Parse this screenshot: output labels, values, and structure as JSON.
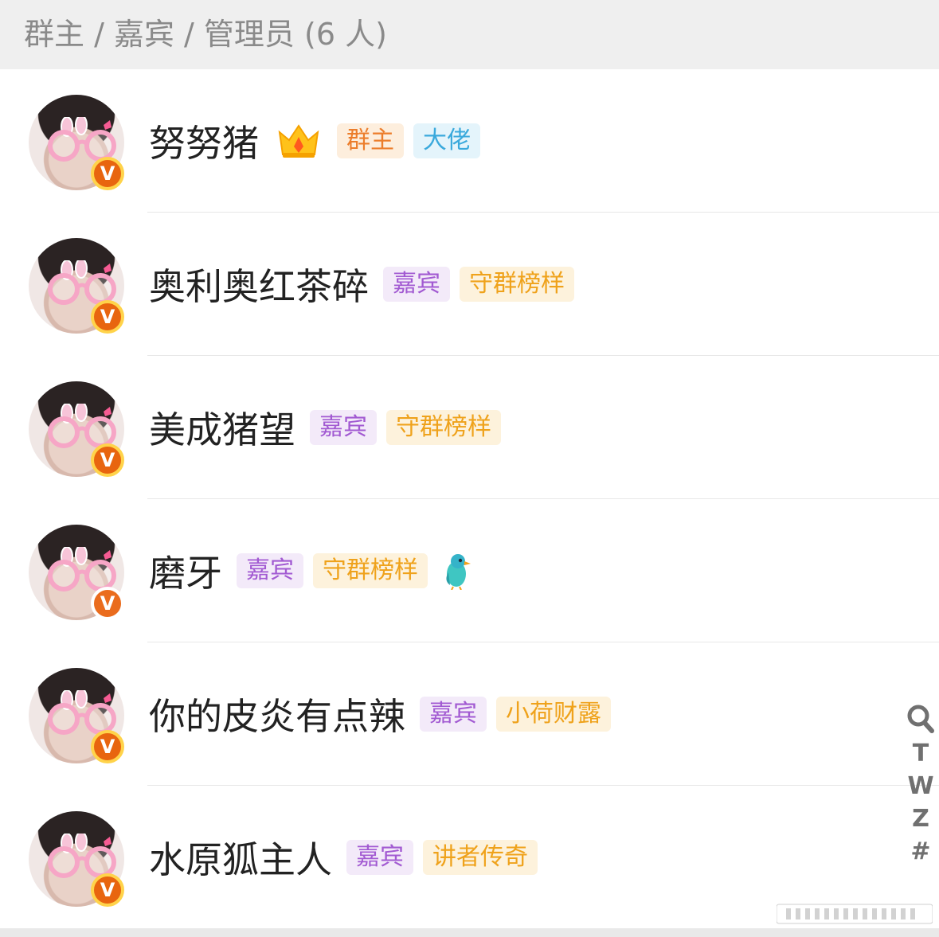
{
  "section": {
    "title": "群主 / 嘉宾 / 管理员 (6 人)"
  },
  "members": [
    {
      "name": "努努猪",
      "crown": true,
      "bird": false,
      "tags": [
        {
          "text": "群主",
          "kind": "owner"
        },
        {
          "text": "大佬",
          "kind": "boss"
        }
      ]
    },
    {
      "name": "奥利奥红茶碎",
      "crown": false,
      "bird": false,
      "tags": [
        {
          "text": "嘉宾",
          "kind": "guest"
        },
        {
          "text": "守群榜样",
          "kind": "gold"
        }
      ]
    },
    {
      "name": "美成猪望",
      "crown": false,
      "bird": false,
      "tags": [
        {
          "text": "嘉宾",
          "kind": "guest"
        },
        {
          "text": "守群榜样",
          "kind": "gold"
        }
      ]
    },
    {
      "name": "磨牙",
      "crown": false,
      "bird": true,
      "tags": [
        {
          "text": "嘉宾",
          "kind": "guest"
        },
        {
          "text": "守群榜样",
          "kind": "gold"
        }
      ]
    },
    {
      "name": "你的皮炎有点辣",
      "crown": false,
      "bird": false,
      "tags": [
        {
          "text": "嘉宾",
          "kind": "guest"
        },
        {
          "text": "小荷财露",
          "kind": "gold"
        }
      ]
    },
    {
      "name": "水原狐主人",
      "crown": false,
      "bird": false,
      "tags": [
        {
          "text": "嘉宾",
          "kind": "guest"
        },
        {
          "text": "讲者传奇",
          "kind": "gold"
        }
      ]
    }
  ],
  "verify_badge": "V",
  "index_bar": {
    "letters": [
      "T",
      "W",
      "Z",
      "#"
    ],
    "search_icon": "search-icon"
  },
  "icons": {
    "crown": "crown-icon",
    "bird": "bird-icon",
    "verified": "verified-badge-icon"
  },
  "colors": {
    "owner": "#ec7d2b",
    "boss": "#3aa9dc",
    "guest": "#a25ad2",
    "gold": "#efa21b",
    "badge": "#e8650f"
  }
}
